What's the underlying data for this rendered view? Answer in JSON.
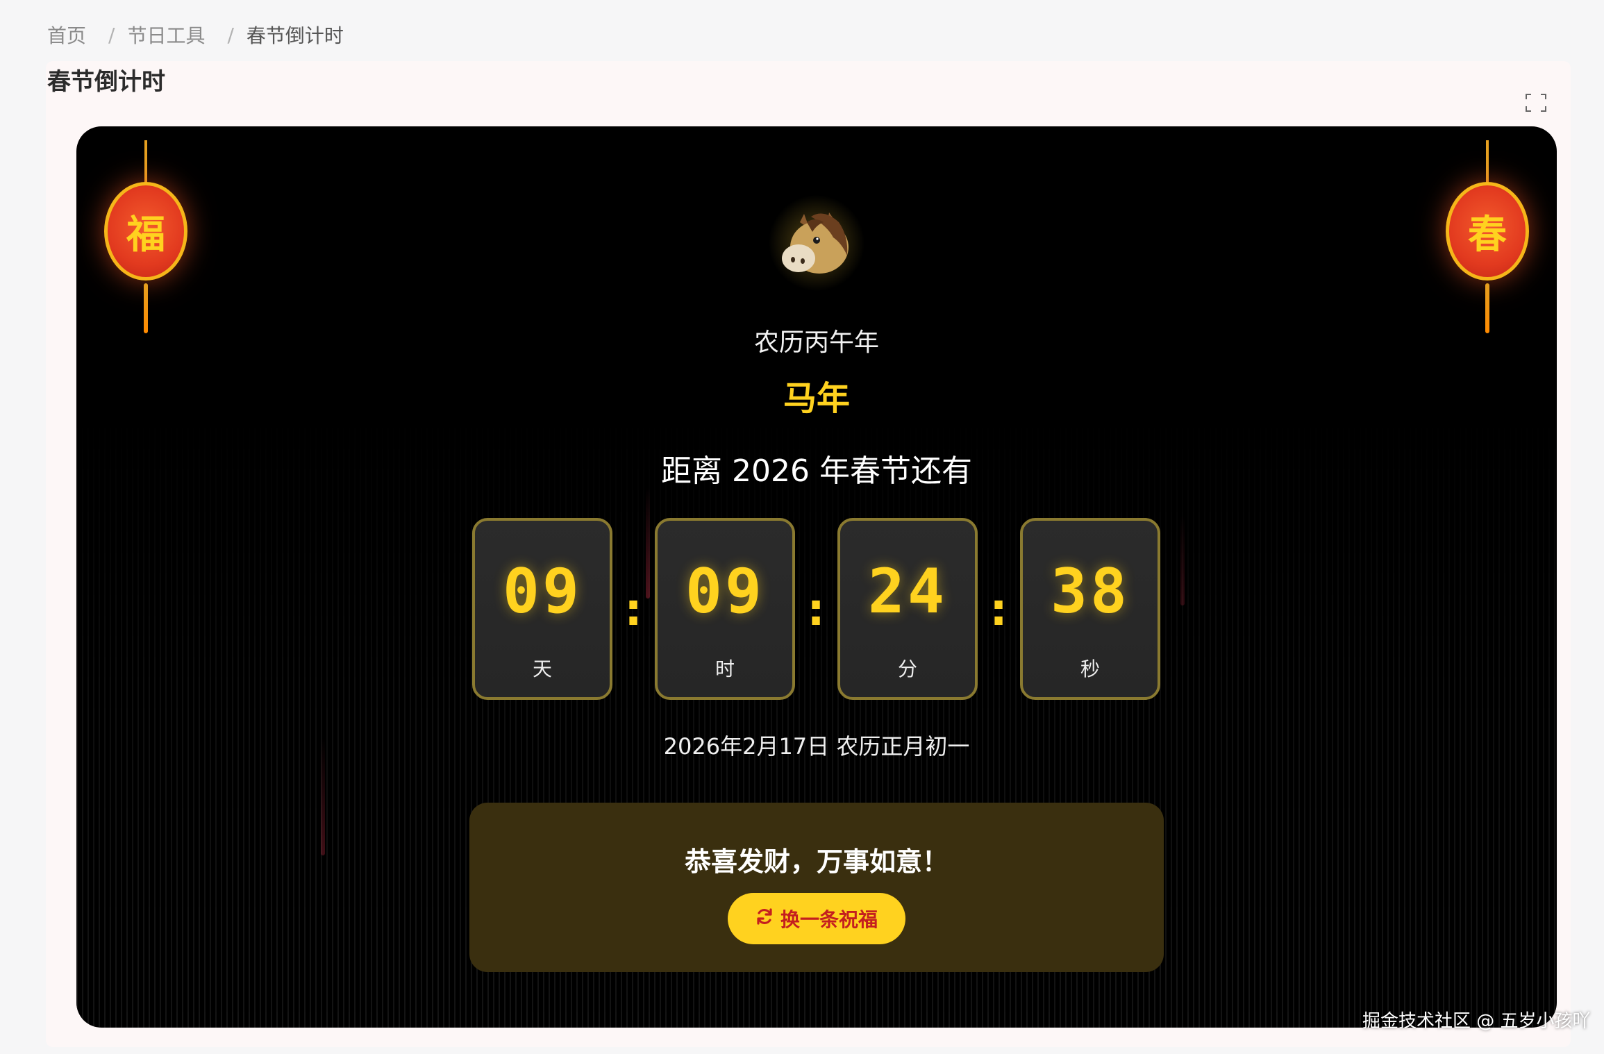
{
  "breadcrumb": {
    "items": [
      "首页",
      "节日工具",
      "春节倒计时"
    ],
    "separator": "/"
  },
  "page": {
    "title": "春节倒计时"
  },
  "lanterns": {
    "left": "福",
    "right": "春"
  },
  "zodiac": {
    "label": "农历丙午年",
    "name": "马年",
    "icon": "horse-icon"
  },
  "countdown": {
    "title": "距离 2026 年春节还有",
    "units": [
      {
        "value": "09",
        "label": "天"
      },
      {
        "value": "09",
        "label": "时"
      },
      {
        "value": "24",
        "label": "分"
      },
      {
        "value": "38",
        "label": "秒"
      }
    ],
    "separator": ":"
  },
  "date_line": "2026年2月17日 农历正月初一",
  "wish": {
    "text": "恭喜发财，万事如意！",
    "button_label": "换一条祝福",
    "button_icon": "refresh-icon"
  },
  "watermark": "掘金技术社区 @ 五岁小孩吖",
  "colors": {
    "accent_gold": "#ffd21f",
    "lantern_red": "#e23a1f",
    "stage_bg": "#000000",
    "wish_bg": "#3a2f0f"
  }
}
